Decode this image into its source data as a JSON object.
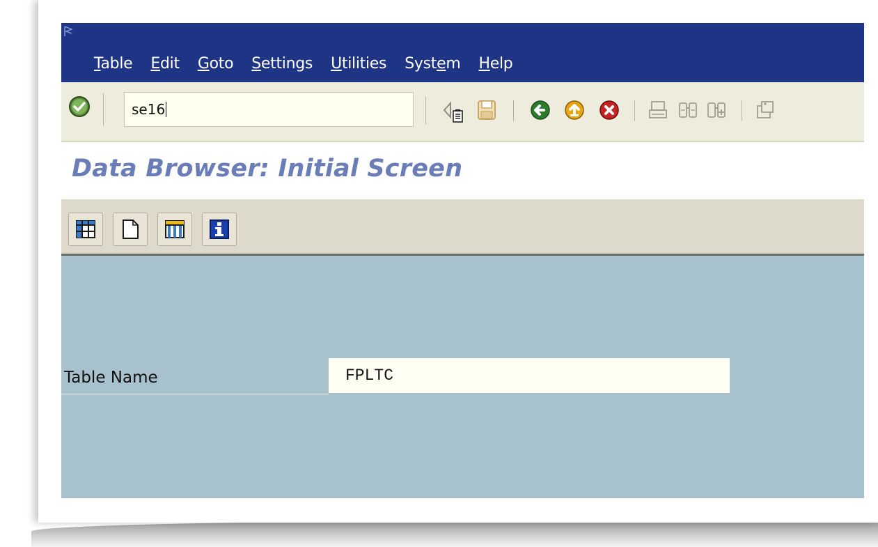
{
  "menubar": {
    "items": [
      {
        "before": "",
        "underlined": "T",
        "after": "able"
      },
      {
        "before": "",
        "underlined": "E",
        "after": "dit"
      },
      {
        "before": "",
        "underlined": "G",
        "after": "oto"
      },
      {
        "before": "",
        "underlined": "S",
        "after": "ettings"
      },
      {
        "before": "",
        "underlined": "U",
        "after": "tilities"
      },
      {
        "before": "Syst",
        "underlined": "e",
        "after": "m"
      },
      {
        "before": "",
        "underlined": "H",
        "after": "elp"
      }
    ]
  },
  "toolbar": {
    "command_value": "se16",
    "icons": [
      "enter-icon",
      "command-history-icon",
      "back-triangle-icon",
      "save-icon",
      "back-icon",
      "exit-icon",
      "cancel-icon",
      "print-icon",
      "find-icon",
      "find-next-icon",
      "create-session-icon"
    ]
  },
  "title": "Data Browser: Initial Screen",
  "app_toolbar": {
    "icons": [
      "table-contents-icon",
      "create-entries-icon",
      "table-view-icon",
      "info-icon"
    ]
  },
  "form": {
    "table_name_label": "Table Name",
    "table_name_value": "FPLTC"
  },
  "colors": {
    "menubar_bg": "#1e3586",
    "toolbar_bg": "#eeecdd",
    "title_color": "#6b7db6",
    "app_toolbar_bg": "#dedacb",
    "workarea_bg": "#a7c1cd",
    "input_bg": "#fffff3"
  }
}
